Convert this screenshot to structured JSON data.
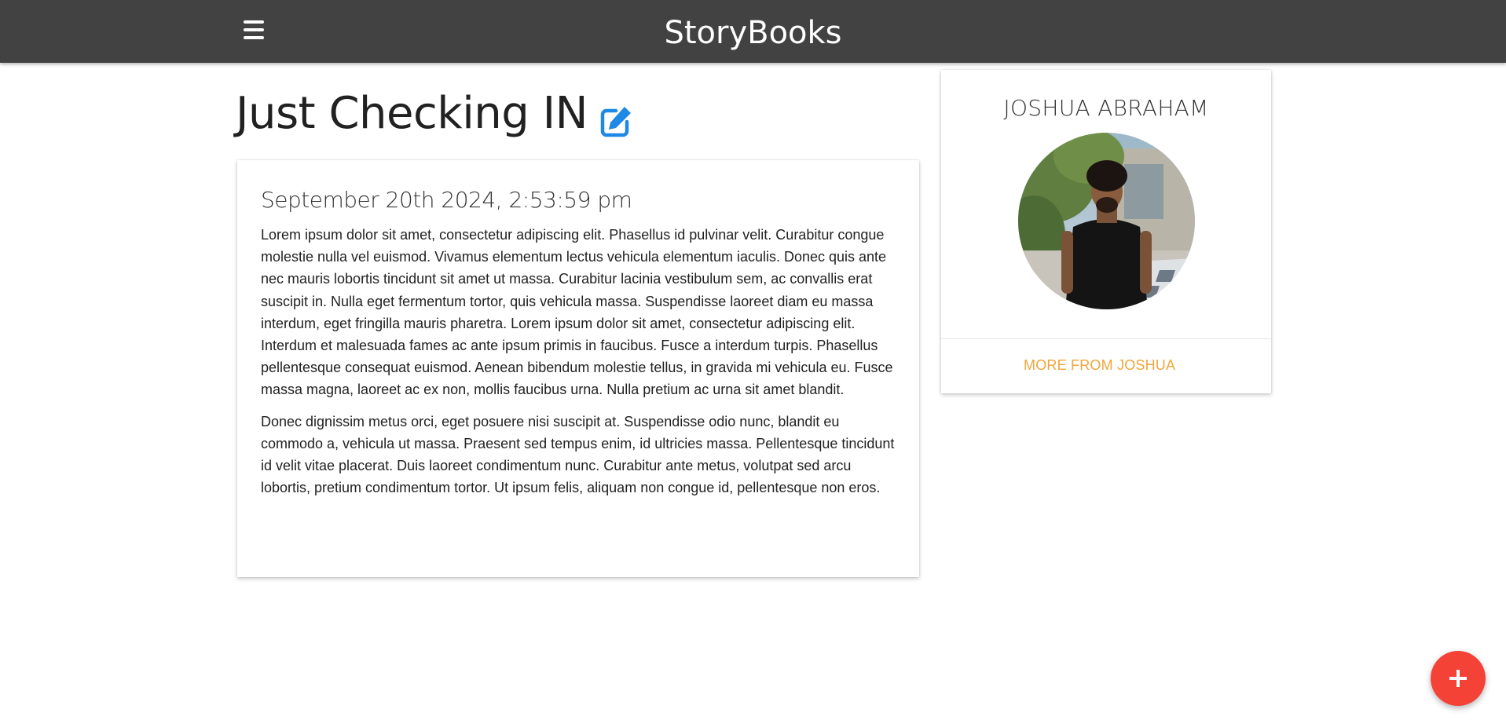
{
  "navbar": {
    "brand": "StoryBooks",
    "menu_icon": "hamburger-menu-icon",
    "background": "#424242"
  },
  "story": {
    "title": "Just Checking IN",
    "edit_icon": "edit-icon",
    "date": "September 20th 2024, 2:53:59 pm",
    "paragraphs": [
      "Lorem ipsum dolor sit amet, consectetur adipiscing elit. Phasellus id pulvinar velit. Curabitur congue molestie nulla vel euismod. Vivamus elementum lectus vehicula elementum iaculis. Donec quis ante nec mauris lobortis tincidunt sit amet ut massa. Curabitur lacinia vestibulum sem, ac convallis erat suscipit in. Nulla eget fermentum tortor, quis vehicula massa. Suspendisse laoreet diam eu massa interdum, eget fringilla mauris pharetra. Lorem ipsum dolor sit amet, consectetur adipiscing elit. Interdum et malesuada fames ac ante ipsum primis in faucibus. Fusce a interdum turpis. Phasellus pellentesque consequat euismod. Aenean bibendum molestie tellus, in gravida mi vehicula eu. Fusce massa magna, laoreet ac ex non, mollis faucibus urna. Nulla pretium ac urna sit amet blandit.",
      "Donec dignissim metus orci, eget posuere nisi suscipit at. Suspendisse odio nunc, blandit eu commodo a, vehicula ut massa. Praesent sed tempus enim, id ultricies massa. Pellentesque tincidunt id velit vitae placerat. Duis laoreet condimentum nunc. Curabitur ante metus, volutpat sed arcu lobortis, pretium condimentum tortor. Ut ipsum felis, aliquam non congue id, pellentesque non eros."
    ]
  },
  "author": {
    "name": "JOSHUA ABRAHAM",
    "more_link": "MORE FROM JOSHUA",
    "link_color": "#f0a53a"
  },
  "fab": {
    "icon": "plus-icon",
    "color": "#f44336"
  }
}
